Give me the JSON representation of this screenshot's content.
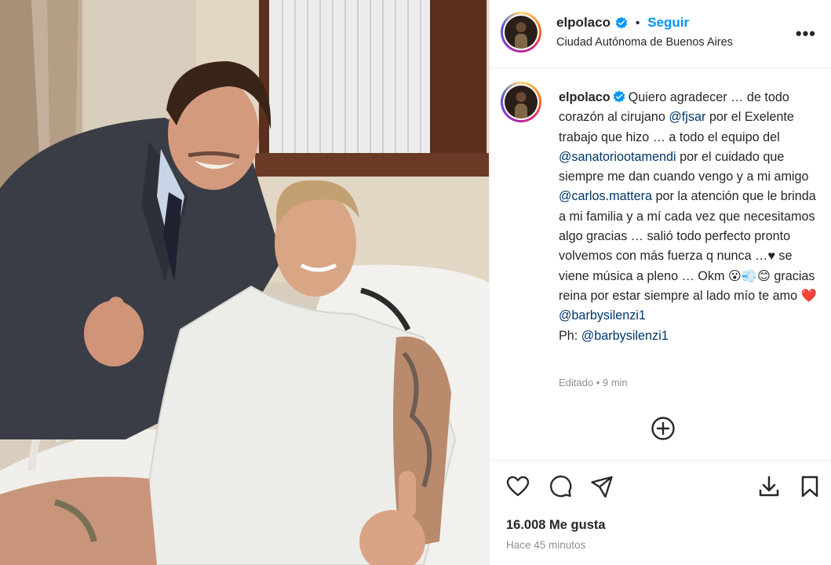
{
  "post": {
    "username": "elpolaco",
    "separator": "•",
    "follow_label": "Seguir",
    "location": "Ciudad Autónoma de Buenos Aires",
    "more_label": "•••",
    "edited": "Editado • 9 min",
    "likes": "16.008 Me gusta",
    "posted": "Hace 45 minutos"
  },
  "caption": {
    "username": "elpolaco",
    "t1": "Quiero agradecer … de todo corazón al cirujano ",
    "m1": "@fjsar",
    "t2": " por el Exelente trabajo que hizo … a todo el equipo del ",
    "m2": "@sanatoriootamendi",
    "t3": " por el cuidado que siempre me dan cuando vengo y a mi amigo ",
    "m3": "@carlos.mattera",
    "t4": " por la atención que le brinda a mi familia y a mí cada vez que necesitamos algo gracias … salió todo perfecto pronto volvemos con más fuerza q nunca …♥ se viene música a pleno … Okm 😮💨😊 gracias reina por estar siempre al lado mío te amo ❤️ ",
    "m4": "@barbysilenzi1",
    "t5": "Ph: ",
    "m5": "@barbysilenzi1"
  },
  "icons": {
    "verified": "verified-badge-icon",
    "add_comment": "plus-circle-icon",
    "like": "heart-icon",
    "comment": "comment-bubble-icon",
    "share": "paper-plane-icon",
    "download": "download-icon",
    "save": "bookmark-icon"
  },
  "colors": {
    "link_blue": "#0095f6",
    "mention": "#00376b",
    "muted": "#8e8e8e",
    "text": "#262626"
  }
}
